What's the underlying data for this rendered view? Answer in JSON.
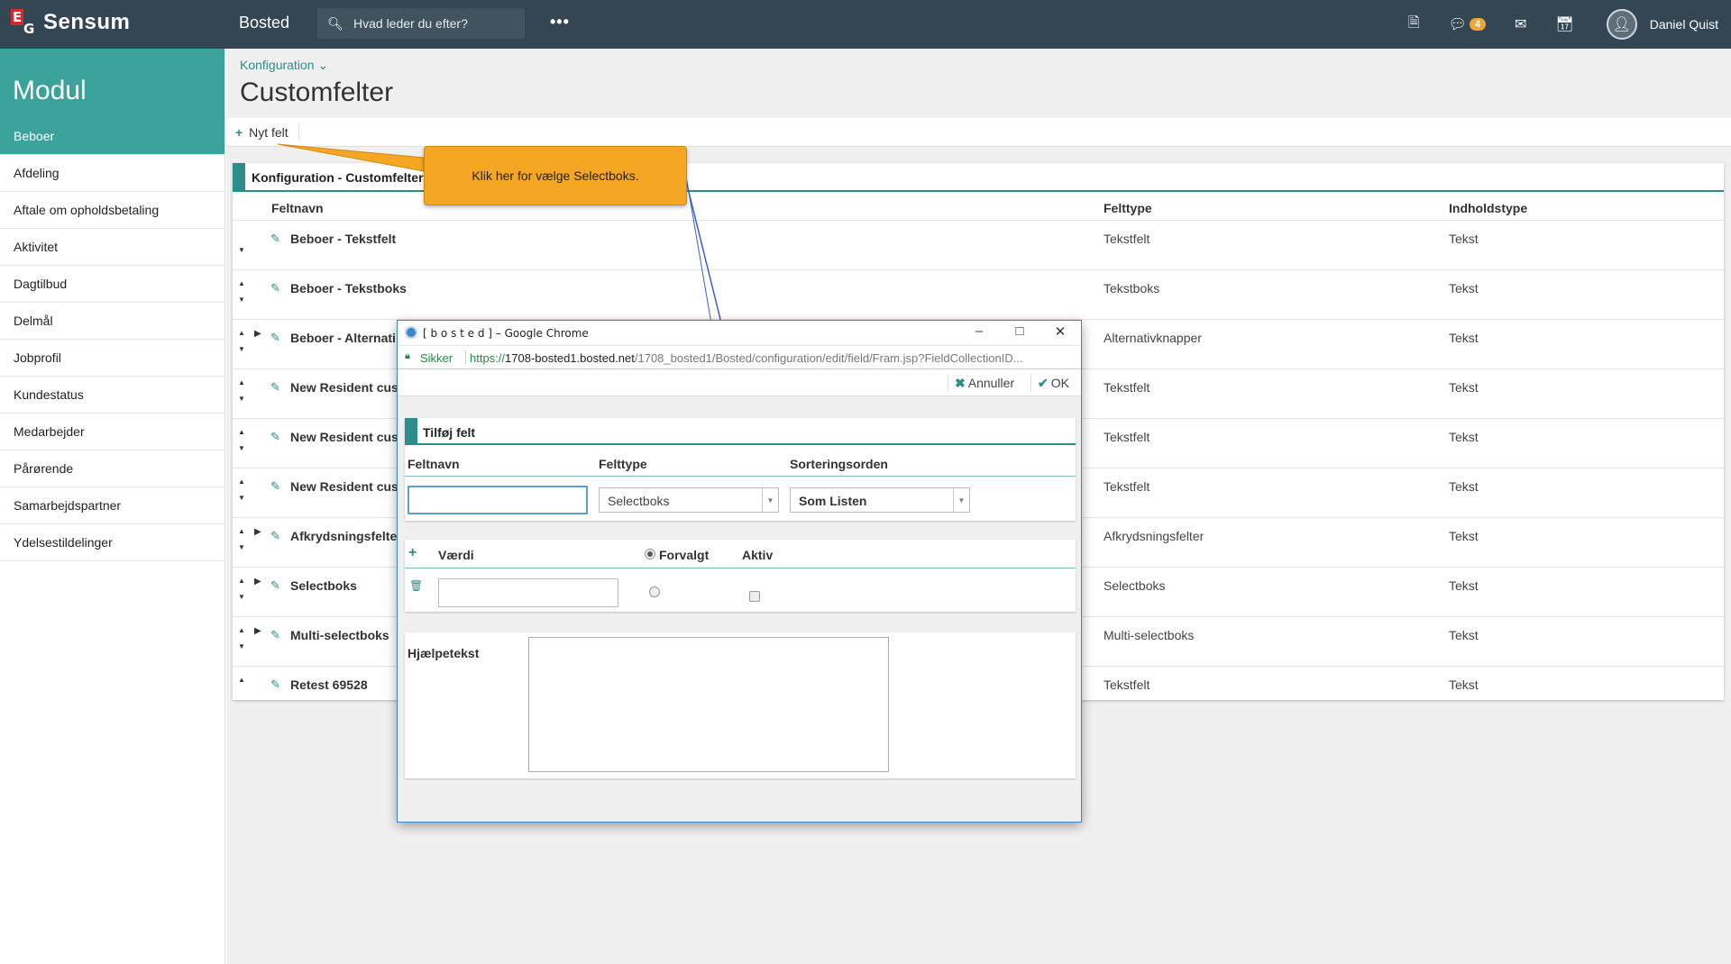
{
  "topbar": {
    "brand": "Sensum",
    "logo_letters": "EG",
    "app_name": "Bosted",
    "search_placeholder": "Hvad leder du efter?",
    "more_label": "•••",
    "notification_count": "4",
    "user_name": "Daniel Quist",
    "icons": [
      "document-icon",
      "chat-icon",
      "mail-icon",
      "calendar-icon",
      "avatar-icon"
    ]
  },
  "sidebar": {
    "heading": "Modul",
    "items": [
      {
        "label": "Beboer",
        "active": true
      },
      {
        "label": "Afdeling"
      },
      {
        "label": "Aftale om opholdsbetaling"
      },
      {
        "label": "Aktivitet"
      },
      {
        "label": "Dagtilbud"
      },
      {
        "label": "Delmål"
      },
      {
        "label": "Jobprofil"
      },
      {
        "label": "Kundestatus"
      },
      {
        "label": "Medarbejder"
      },
      {
        "label": "Pårørende"
      },
      {
        "label": "Samarbejdspartner"
      },
      {
        "label": "Ydelsestildelinger"
      }
    ]
  },
  "page": {
    "breadcrumb": "Konfiguration",
    "title": "Customfelter",
    "new_field_label": "Nyt felt"
  },
  "panel": {
    "title": "Konfiguration - Customfelter",
    "columns": {
      "name": "Feltnavn",
      "type": "Felttype",
      "content": "Indholdstype"
    },
    "rows": [
      {
        "name": "Beboer - Tekstfelt",
        "type": "Tekstfelt",
        "content": "Tekst",
        "up": false,
        "down": true,
        "expand": false
      },
      {
        "name": "Beboer - Tekstboks",
        "type": "Tekstboks",
        "content": "Tekst",
        "up": true,
        "down": true,
        "expand": false
      },
      {
        "name": "Beboer - Alternati",
        "type": "Alternativknapper",
        "content": "Tekst",
        "up": true,
        "down": true,
        "expand": true
      },
      {
        "name": "New Resident cus",
        "type": "Tekstfelt",
        "content": "Tekst",
        "up": true,
        "down": true,
        "expand": false
      },
      {
        "name": "New Resident cus",
        "type": "Tekstfelt",
        "content": "Tekst",
        "up": true,
        "down": true,
        "expand": false
      },
      {
        "name": "New Resident cus",
        "type": "Tekstfelt",
        "content": "Tekst",
        "up": true,
        "down": true,
        "expand": false
      },
      {
        "name": "Afkrydsningsfelte",
        "type": "Afkrydsningsfelter",
        "content": "Tekst",
        "up": true,
        "down": true,
        "expand": true
      },
      {
        "name": "Selectboks",
        "type": "Selectboks",
        "content": "Tekst",
        "up": true,
        "down": true,
        "expand": true
      },
      {
        "name": "Multi-selectboks",
        "type": "Multi-selectboks",
        "content": "Tekst",
        "up": true,
        "down": true,
        "expand": true
      },
      {
        "name": "Retest 69528",
        "type": "Tekstfelt",
        "content": "Tekst",
        "up": true,
        "down": false,
        "expand": false
      }
    ]
  },
  "callout": {
    "text": "Klik her for vælge Selectboks."
  },
  "modal": {
    "window_title": "[ b o s t e d ] – Google Chrome",
    "secure_label": "Sikker",
    "url_scheme": "https://",
    "url_host": "1708-bosted1.bosted.net",
    "url_path": "/1708_bosted1/Bosted/configuration/edit/field/Fram.jsp?FieldCollectionID...",
    "cancel_label": "Annuller",
    "ok_label": "OK",
    "section_title": "Tilføj felt",
    "field_name_label": "Feltnavn",
    "field_type_label": "Felttype",
    "sort_order_label": "Sorteringsorden",
    "field_name_value": "",
    "field_type_value": "Selectboks",
    "sort_order_value": "Som Listen",
    "value_label": "Værdi",
    "default_label": "Forvalgt",
    "active_label": "Aktiv",
    "help_text_label": "Hjælpetekst"
  }
}
